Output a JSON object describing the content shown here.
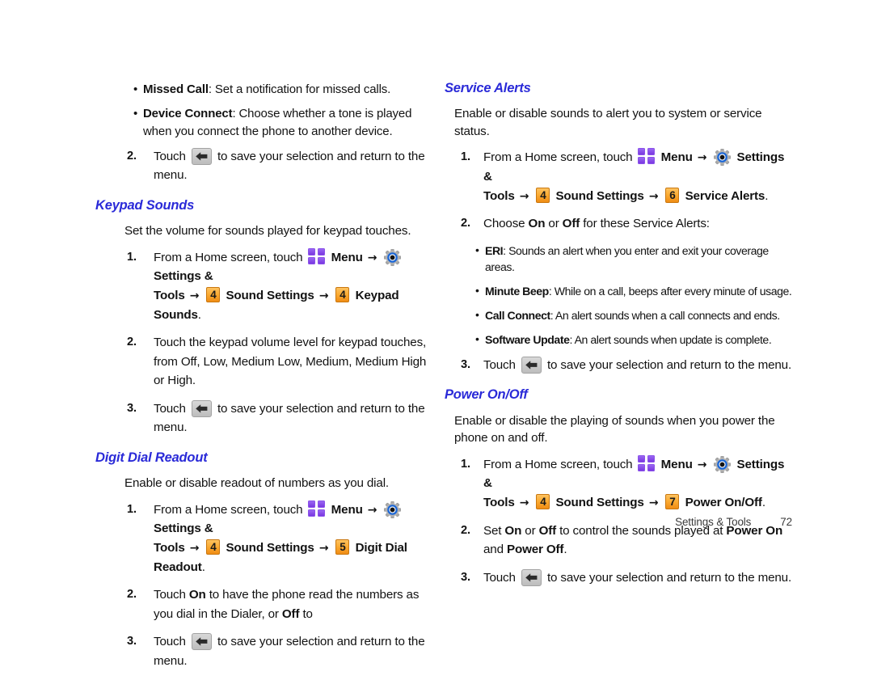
{
  "document": {
    "footer": {
      "section": "Settings & Tools",
      "page": "72"
    }
  },
  "icons": {
    "menu": "menu-grid-icon",
    "settings": "gear-icon",
    "back": "back-arrow-icon"
  },
  "colors": {
    "heading": "#2a2ad8",
    "key_badge": "#fbab33",
    "menu_icon": "#7a37e0",
    "gear_ring": "#1a66d6"
  },
  "left_column": {
    "top_bullets": [
      {
        "bold": "Missed Call",
        "rest": ": Set a notification for missed calls."
      },
      {
        "bold": "Device Connect",
        "rest": ": Choose whether a tone is played when you connect the phone to another device."
      }
    ],
    "top_step": {
      "num": "2.",
      "pre": "Touch",
      "post": "to save your selection and return to the menu."
    },
    "sections": [
      {
        "heading": "Keypad Sounds",
        "intro": "Set the volume for sounds played for keypad touches.",
        "step1": {
          "num": "1.",
          "t1": "From a Home screen, touch",
          "menu_label": "Menu",
          "settings_label": "Settings &",
          "tools_label": "Tools",
          "key_a": "4",
          "sound_label": "Sound Settings",
          "key_b": "4",
          "target_label": "Keypad Sounds",
          "period": "."
        },
        "step2": {
          "num": "2.",
          "text": "Touch the keypad volume level for keypad touches, from Off, Low, Medium Low, Medium, Medium High or High."
        },
        "step3": {
          "num": "3.",
          "pre": "Touch",
          "post": "to save your selection and return to the menu."
        }
      },
      {
        "heading": "Digit Dial Readout",
        "intro": "Enable or disable readout of numbers as you dial.",
        "step1": {
          "num": "1.",
          "t1": "From a Home screen, touch",
          "menu_label": "Menu",
          "settings_label": "Settings &",
          "tools_label": "Tools",
          "key_a": "4",
          "sound_label": "Sound Settings",
          "key_b": "5",
          "target_label": "Digit Dial Readout",
          "period": "."
        },
        "step2": {
          "num": "2.",
          "p1": "Touch ",
          "b1": "On",
          "p2": " to have the phone read the numbers as you dial in the Dialer, or ",
          "b2": "Off",
          "p3": " to"
        },
        "step3": {
          "num": "3.",
          "pre": "Touch",
          "post": "to save your selection and return to the menu."
        }
      }
    ]
  },
  "right_column": {
    "sections": [
      {
        "heading": "Service Alerts",
        "intro": "Enable or disable sounds to alert you to system or service status.",
        "step1": {
          "num": "1.",
          "t1": "From a Home screen, touch",
          "menu_label": "Menu",
          "settings_label": "Settings &",
          "tools_label": "Tools",
          "key_a": "4",
          "sound_label": "Sound Settings",
          "key_b": "6",
          "target_label": "Service Alerts",
          "period": "."
        },
        "step2": {
          "num": "2.",
          "p1": "Choose ",
          "b1": "On",
          "p2": " or ",
          "b2": "Off",
          "p3": " for these Service Alerts:"
        },
        "alert_bullets": [
          {
            "bold": "ERI",
            "rest": ": Sounds an alert when you enter and exit your coverage areas."
          },
          {
            "bold": "Minute Beep",
            "rest": ": While on a call, beeps after every minute of usage."
          },
          {
            "bold": "Call Connect",
            "rest": ": An alert sounds when a call connects and ends."
          },
          {
            "bold": "Software Update",
            "rest": ": An alert sounds when update is complete."
          }
        ],
        "step3": {
          "num": "3.",
          "pre": "Touch",
          "post": "to save your selection and return to the menu."
        }
      },
      {
        "heading": "Power On/Off",
        "intro": "Enable or disable the playing of sounds when you power the phone on and off.",
        "step1": {
          "num": "1.",
          "t1": "From a Home screen, touch",
          "menu_label": "Menu",
          "settings_label": "Settings &",
          "tools_label": "Tools",
          "key_a": "4",
          "sound_label": "Sound Settings",
          "key_b": "7",
          "target_label": "Power On/Off",
          "period": "."
        },
        "step2": {
          "num": "2.",
          "p1": "Set ",
          "b1": "On",
          "p2": " or ",
          "b2": "Off",
          "p3": " to control the sounds played at ",
          "b3": "Power On",
          "p4": " and ",
          "b4": "Power Off",
          "p5": "."
        },
        "step3": {
          "num": "3.",
          "pre": "Touch",
          "post": "to save your selection and return to the menu."
        }
      }
    ]
  }
}
